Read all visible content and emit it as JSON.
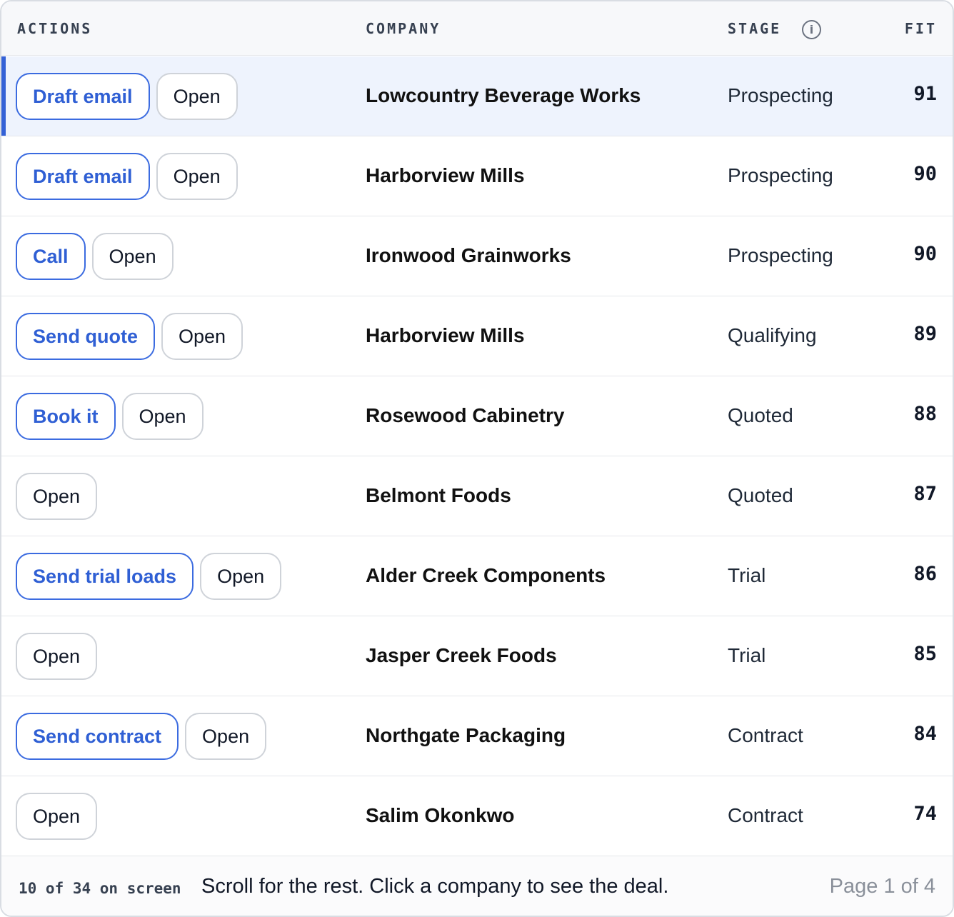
{
  "columns": {
    "actions": "ACTIONS",
    "company": "COMPANY",
    "stage": "STAGE",
    "fit": "FIT",
    "stage_info_icon": "info-icon",
    "stage_info_glyph": "i"
  },
  "colors": {
    "accent": "#3461d6",
    "selected_row": "#eef3fd",
    "border": "#e5e7eb"
  },
  "rows": [
    {
      "primary_action": "Draft email",
      "open_label": "Open",
      "company": "Lowcountry Beverage Works",
      "stage": "Prospecting",
      "fit": "91",
      "selected": true
    },
    {
      "primary_action": "Draft email",
      "open_label": "Open",
      "company": "Harborview Mills",
      "stage": "Prospecting",
      "fit": "90",
      "selected": false
    },
    {
      "primary_action": "Call",
      "open_label": "Open",
      "company": "Ironwood Grainworks",
      "stage": "Prospecting",
      "fit": "90",
      "selected": false
    },
    {
      "primary_action": "Send quote",
      "open_label": "Open",
      "company": "Harborview Mills",
      "stage": "Qualifying",
      "fit": "89",
      "selected": false
    },
    {
      "primary_action": "Book it",
      "open_label": "Open",
      "company": "Rosewood Cabinetry",
      "stage": "Quoted",
      "fit": "88",
      "selected": false
    },
    {
      "primary_action": null,
      "open_label": "Open",
      "company": "Belmont Foods",
      "stage": "Quoted",
      "fit": "87",
      "selected": false
    },
    {
      "primary_action": "Send trial loads",
      "open_label": "Open",
      "company": "Alder Creek Components",
      "stage": "Trial",
      "fit": "86",
      "selected": false
    },
    {
      "primary_action": null,
      "open_label": "Open",
      "company": "Jasper Creek Foods",
      "stage": "Trial",
      "fit": "85",
      "selected": false
    },
    {
      "primary_action": "Send contract",
      "open_label": "Open",
      "company": "Northgate Packaging",
      "stage": "Contract",
      "fit": "84",
      "selected": false
    },
    {
      "primary_action": null,
      "open_label": "Open",
      "company": "Salim Okonkwo",
      "stage": "Contract",
      "fit": "74",
      "selected": false
    }
  ],
  "footer": {
    "count": "10 of 34 on screen",
    "hint": "Scroll for the rest. Click a company to see the deal.",
    "page": "Page 1 of 4"
  }
}
